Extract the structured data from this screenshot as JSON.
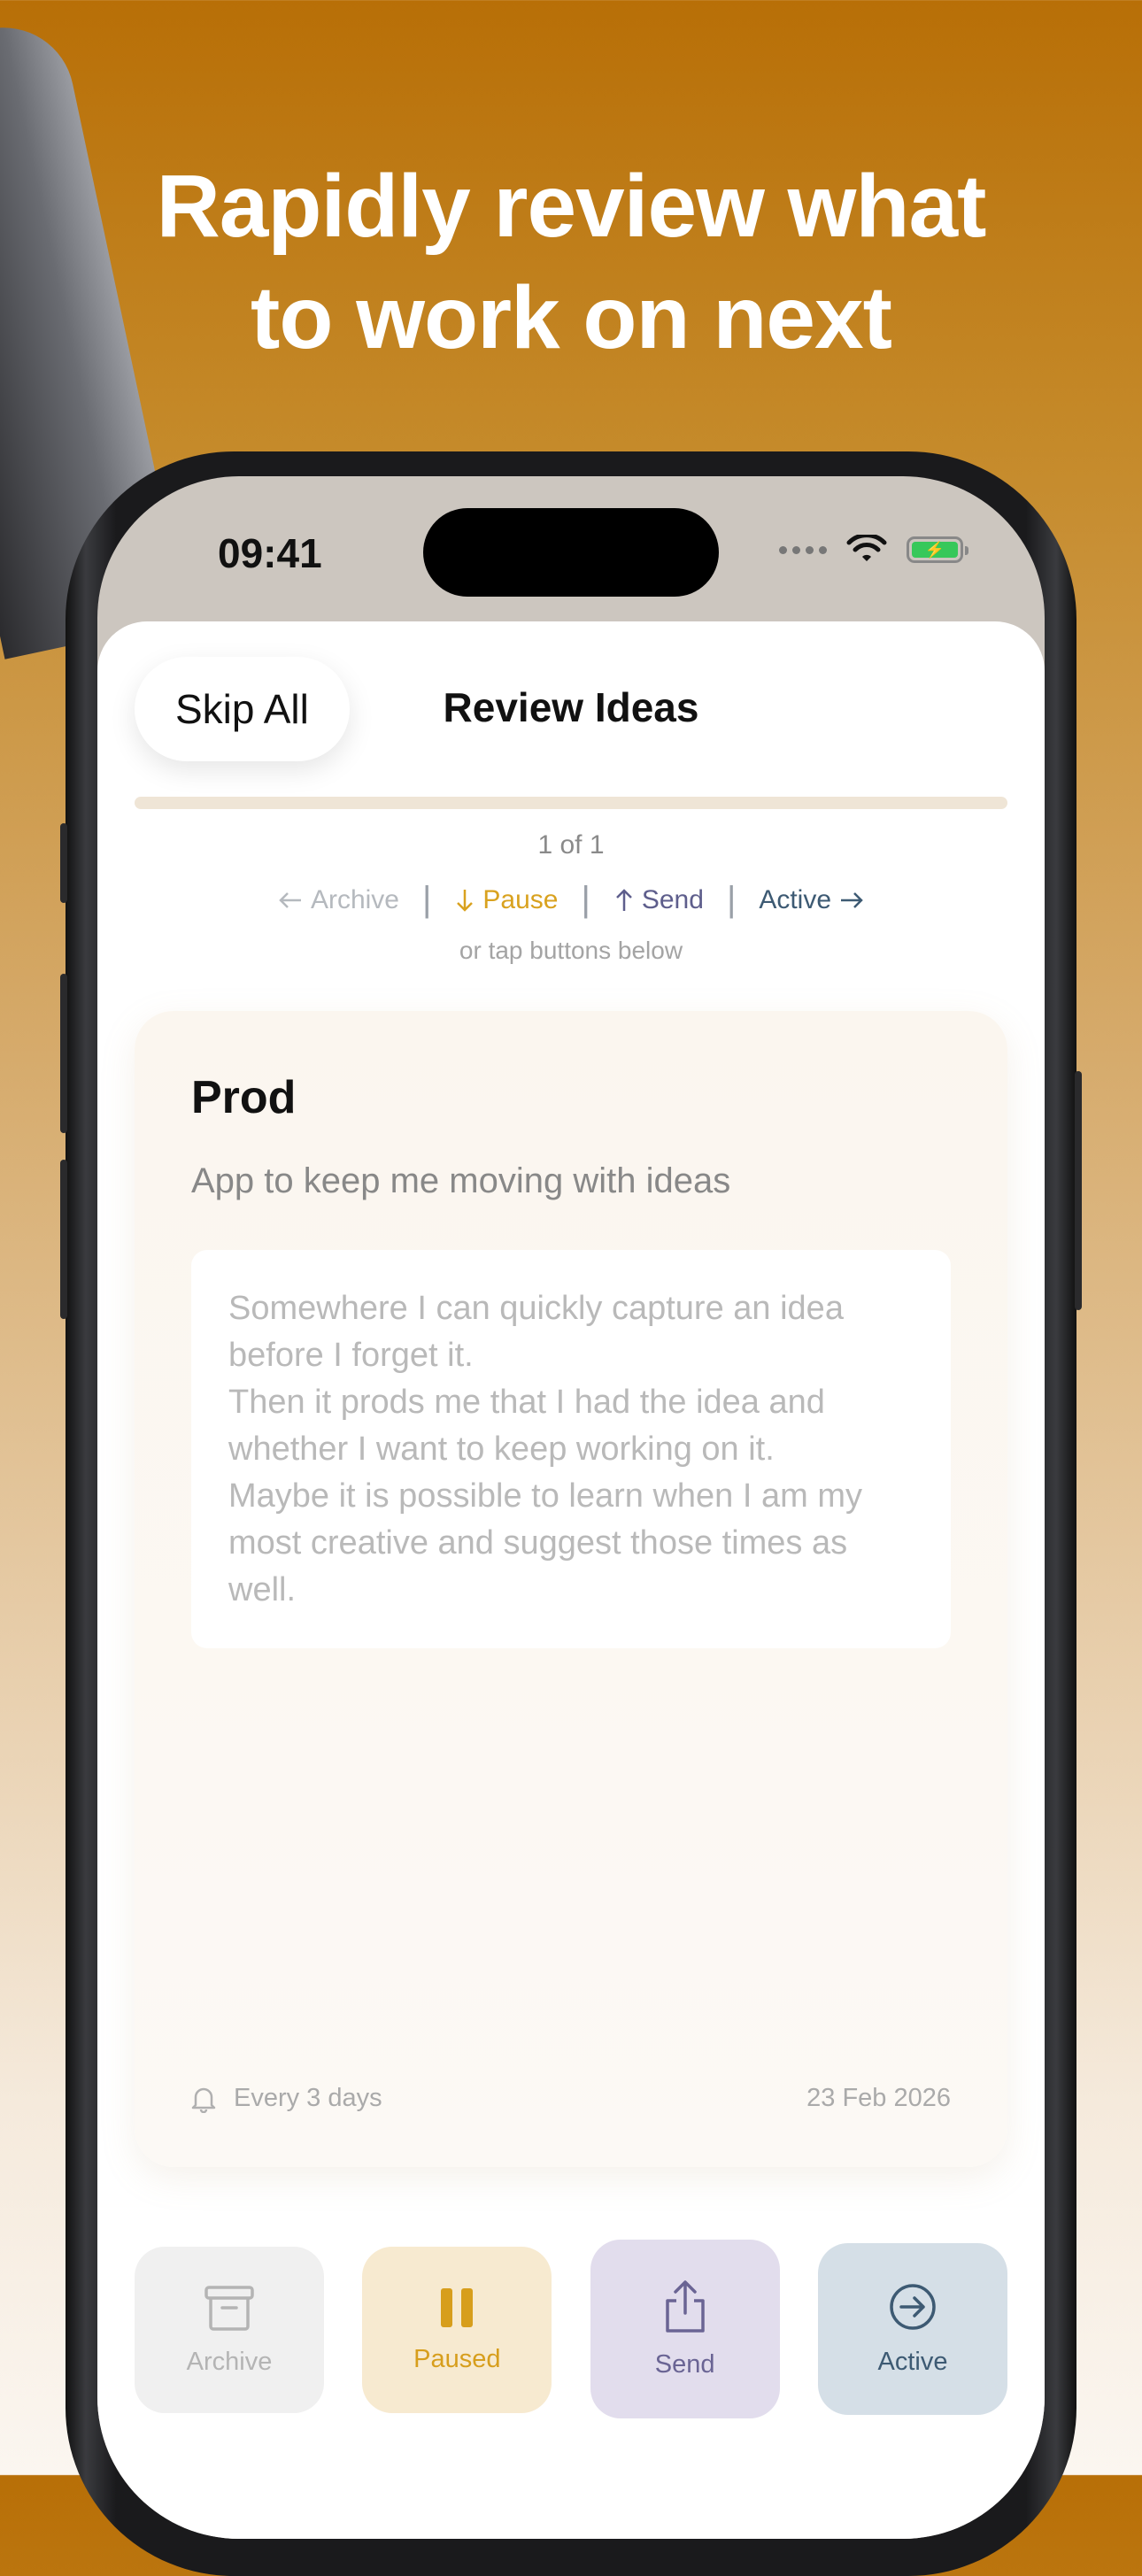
{
  "headline": {
    "line1": "Rapidly review what",
    "line2": "to work on next"
  },
  "status_bar": {
    "time": "09:41"
  },
  "header": {
    "skip_label": "Skip All",
    "title": "Review Ideas"
  },
  "progress": {
    "fraction": 1.0,
    "counter": "1 of 1"
  },
  "hints": {
    "archive": "Archive",
    "pause": "Pause",
    "send": "Send",
    "active": "Active",
    "subhint": "or tap buttons below"
  },
  "card": {
    "title": "Prod",
    "subtitle": "App to keep me moving with ideas",
    "notes": [
      "Somewhere I can quickly capture an idea before I forget it.",
      "Then it prods me that I had the idea and whether I want to keep working on it.",
      "Maybe it is possible to learn when I am my most creative and suggest those times as well."
    ],
    "reminder": "Every 3 days",
    "date": "23 Feb 2026"
  },
  "actions": {
    "archive": "Archive",
    "paused": "Paused",
    "send": "Send",
    "active": "Active"
  },
  "colors": {
    "pause": "#d9a21f",
    "send": "#5e5e8c",
    "active": "#3d5a73",
    "archive_hint": "#b5b9be"
  }
}
